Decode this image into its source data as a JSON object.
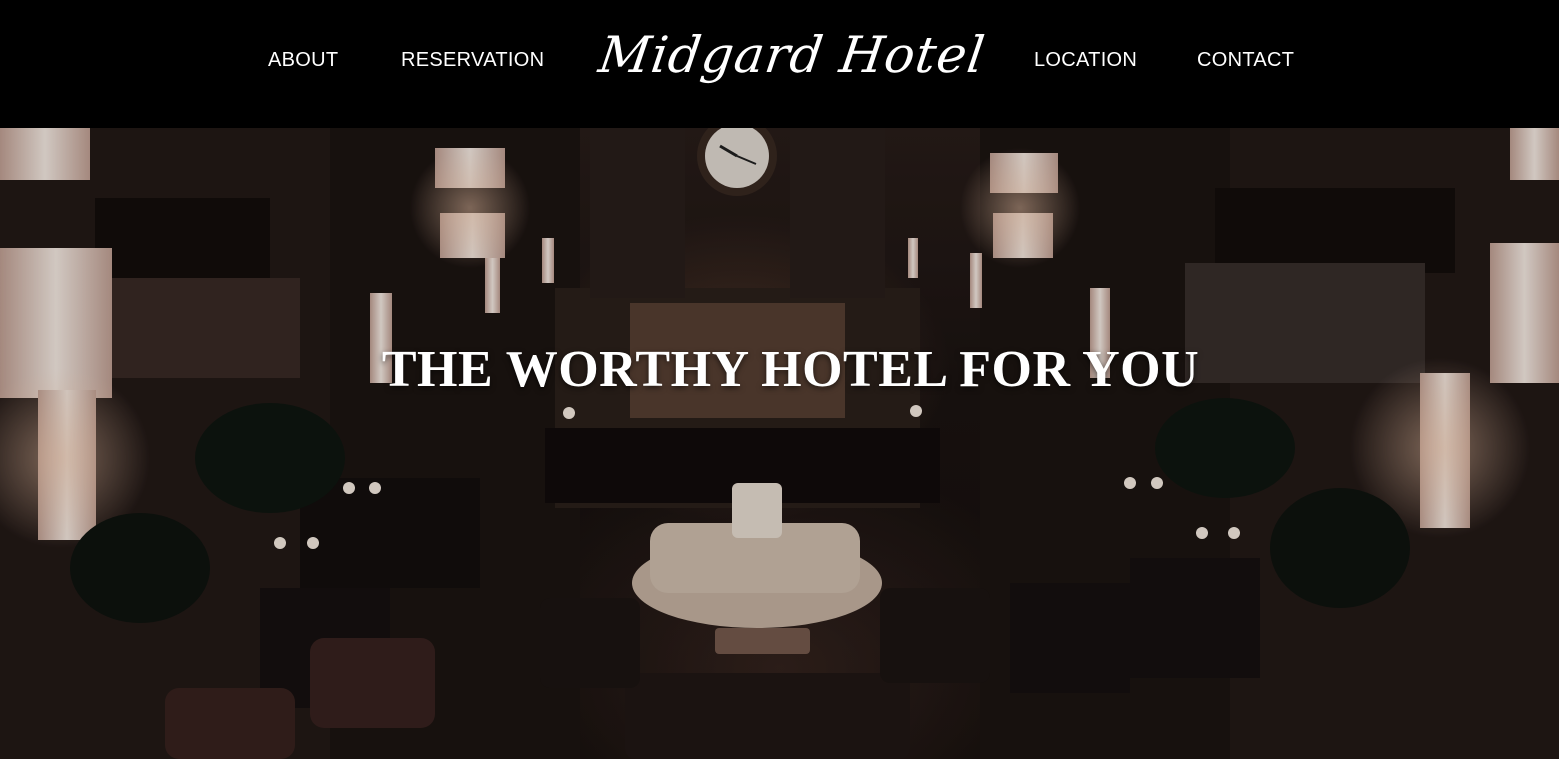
{
  "header": {
    "nav_left": [
      {
        "label": "ABOUT"
      },
      {
        "label": "RESERVATION"
      }
    ],
    "logo_text": "Midgard Hotel",
    "nav_right": [
      {
        "label": "LOCATION"
      },
      {
        "label": "CONTACT"
      }
    ]
  },
  "hero": {
    "title": "THE WORTHY HOTEL FOR YOU",
    "image": "hotel-lobby-bar-photo"
  },
  "colors": {
    "header_bg": "#000000",
    "text": "#ffffff"
  }
}
